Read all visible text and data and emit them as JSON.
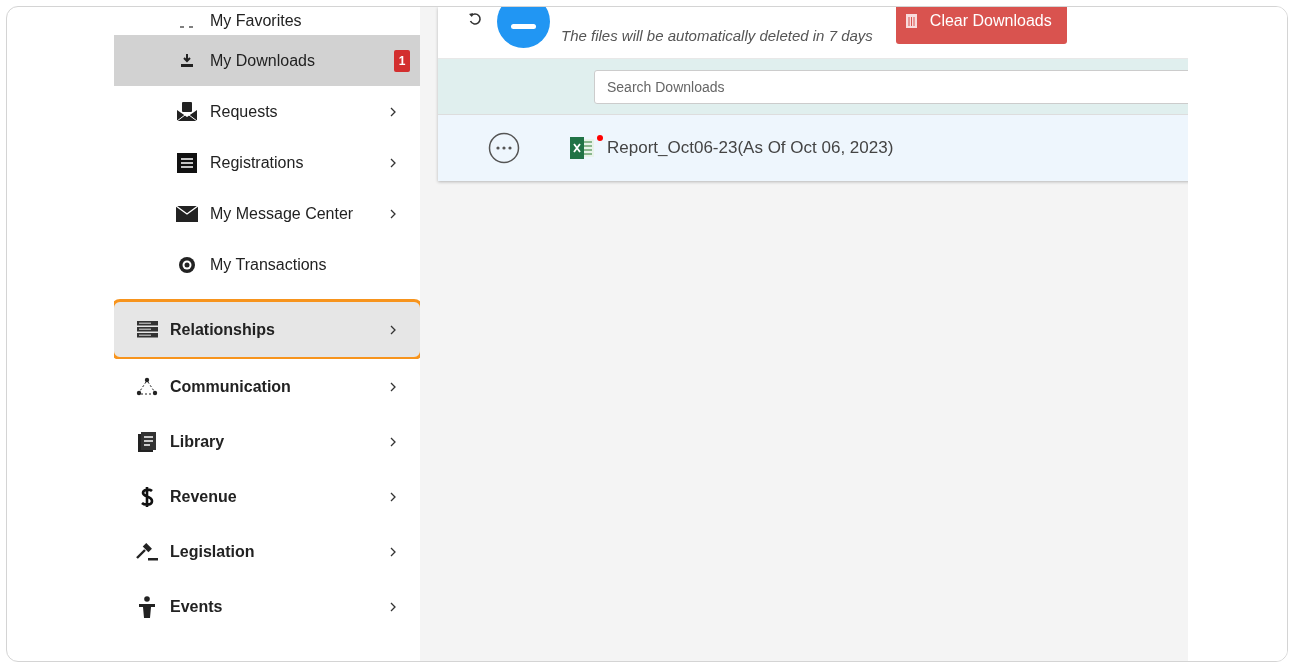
{
  "sidebar": {
    "items": [
      {
        "kind": "subitem",
        "label": "My Favorites",
        "selected": false,
        "highlighted": false,
        "chevron": false
      },
      {
        "kind": "subitem",
        "label": "My Downloads",
        "selected": true,
        "highlighted": false,
        "chevron": false,
        "badge": "1"
      },
      {
        "kind": "subitem",
        "label": "Requests",
        "selected": false,
        "highlighted": false,
        "chevron": true
      },
      {
        "kind": "subitem",
        "label": "Registrations",
        "selected": false,
        "highlighted": false,
        "chevron": true
      },
      {
        "kind": "subitem",
        "label": "My Message Center",
        "selected": false,
        "highlighted": false,
        "chevron": true
      },
      {
        "kind": "subitem",
        "label": "My Transactions",
        "selected": false,
        "highlighted": false,
        "chevron": false
      },
      {
        "kind": "item",
        "label": "Relationships",
        "selected": false,
        "highlighted": true,
        "chevron": true
      },
      {
        "kind": "item",
        "label": "Communication",
        "selected": false,
        "highlighted": false,
        "chevron": true
      },
      {
        "kind": "item",
        "label": "Library",
        "selected": false,
        "highlighted": false,
        "chevron": true
      },
      {
        "kind": "item",
        "label": "Revenue",
        "selected": false,
        "highlighted": false,
        "chevron": true
      },
      {
        "kind": "item",
        "label": "Legislation",
        "selected": false,
        "highlighted": false,
        "chevron": true
      },
      {
        "kind": "item",
        "label": "Events",
        "selected": false,
        "highlighted": false,
        "chevron": true
      }
    ]
  },
  "downloads": {
    "notice": "The files will be automatically deleted in 7 days",
    "clear_button": "Clear Downloads",
    "search": {
      "placeholder": "Search Downloads"
    },
    "files": [
      {
        "name": "Report_Oct06-23(As Of Oct 06, 2023)",
        "unread": true
      }
    ]
  }
}
